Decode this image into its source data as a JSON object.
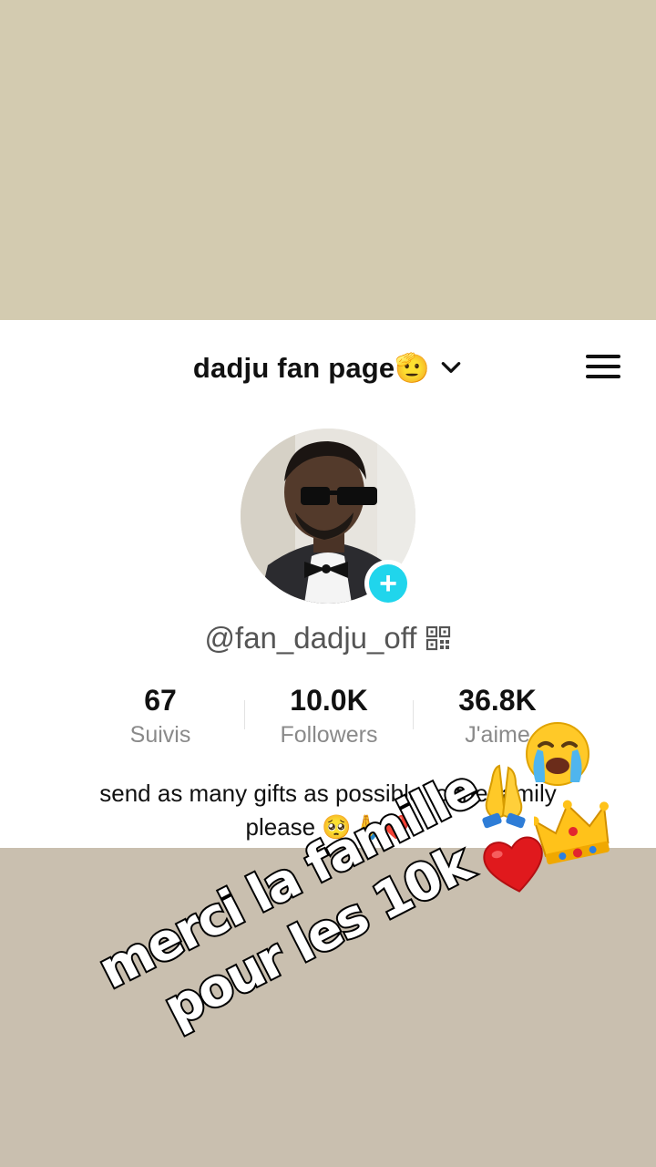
{
  "profile": {
    "title": "dadju fan page🫡",
    "handle": "@fan_dadju_off",
    "bio": "send as many gifts as possible to the family please 🥺🙏❤️"
  },
  "stats": [
    {
      "value": "67",
      "label": "Suivis"
    },
    {
      "value": "10.0K",
      "label": "Followers"
    },
    {
      "value": "36.8K",
      "label": "J'aime"
    }
  ],
  "overlay": {
    "line1": "merci la famille",
    "line2": "pour les 10k"
  },
  "icons": {
    "menu": "hamburger-icon",
    "chevron": "chevron-down-icon",
    "qr": "qr-code-icon",
    "add": "plus-icon"
  },
  "colors": {
    "accent": "#20d5ec",
    "background_top": "#d3cbb0",
    "background_bottom": "#c9bfaf"
  }
}
